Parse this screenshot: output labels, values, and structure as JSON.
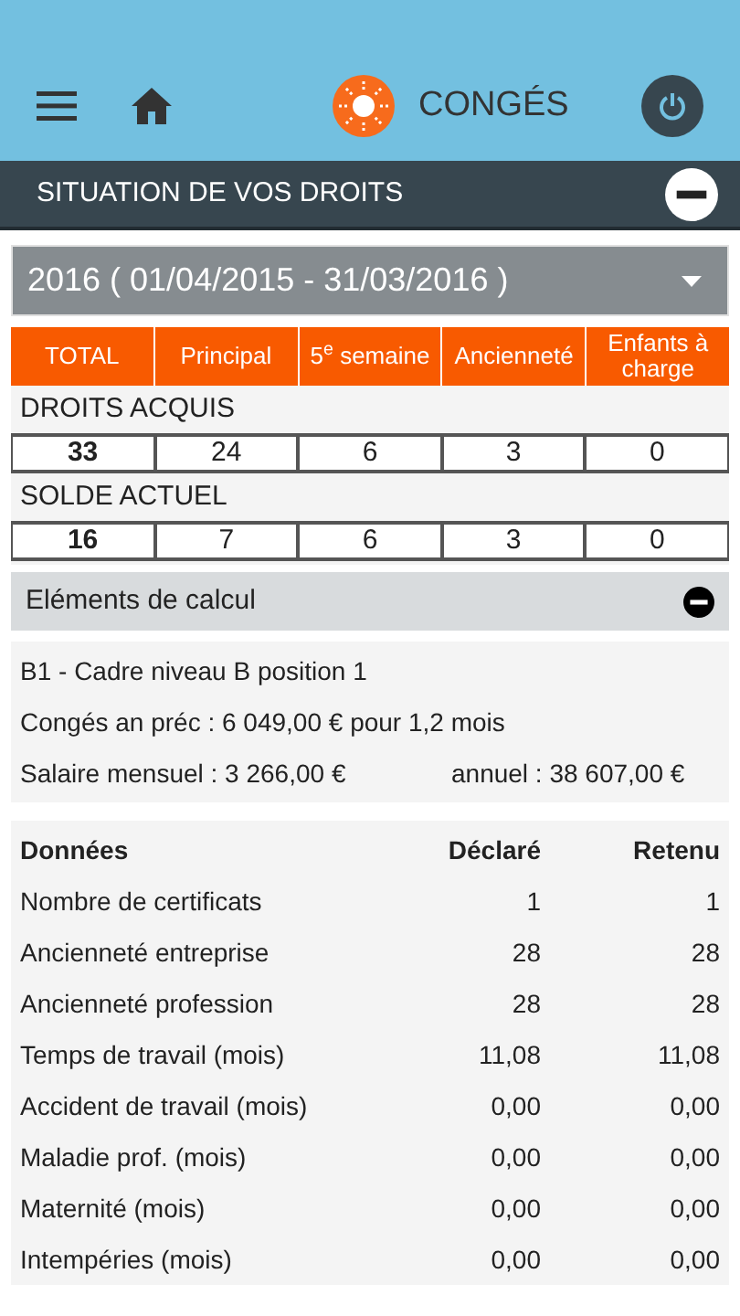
{
  "app_bar": {
    "title": "CONGÉS"
  },
  "section": {
    "title": "SITUATION DE VOS DROITS",
    "expanded": true
  },
  "period": {
    "value": "2016 ( 01/04/2015 - 31/03/2016 )"
  },
  "columns": [
    "TOTAL",
    "Principal",
    "5$^{e}$ semaine",
    "Ancienneté",
    "Enfants à charge"
  ],
  "groups": [
    {
      "label": "DROITS ACQUIS",
      "values": [
        "33",
        "24",
        "6",
        "3",
        "0"
      ]
    },
    {
      "label": "SOLDE ACTUEL",
      "values": [
        "16",
        "7",
        "6",
        "3",
        "0"
      ]
    }
  ],
  "calcul": {
    "title": "Eléments de calcul",
    "expanded": true,
    "lines": [
      "B1 - Cadre niveau B position 1",
      "Congés an préc : 6 049,00 € pour 1,2 mois"
    ],
    "monthly": "Salaire mensuel : 3 266,00 €",
    "annual": "annuel : 38 607,00 €"
  },
  "table": {
    "columns": [
      "Données",
      "Déclaré",
      "Retenu"
    ],
    "rows": [
      [
        "Nombre de certificats",
        "1",
        "1"
      ],
      [
        "Ancienneté entreprise",
        "28",
        "28"
      ],
      [
        "Ancienneté profession",
        "28",
        "28"
      ],
      [
        "Temps de travail (mois)",
        "11,08",
        "11,08"
      ],
      [
        "Accident de travail (mois)",
        "0,00",
        "0,00"
      ],
      [
        "Maladie prof. (mois)",
        "0,00",
        "0,00"
      ],
      [
        "Maternité (mois)",
        "0,00",
        "0,00"
      ],
      [
        "Intempéries (mois)",
        "0,00",
        "0,00"
      ]
    ]
  }
}
